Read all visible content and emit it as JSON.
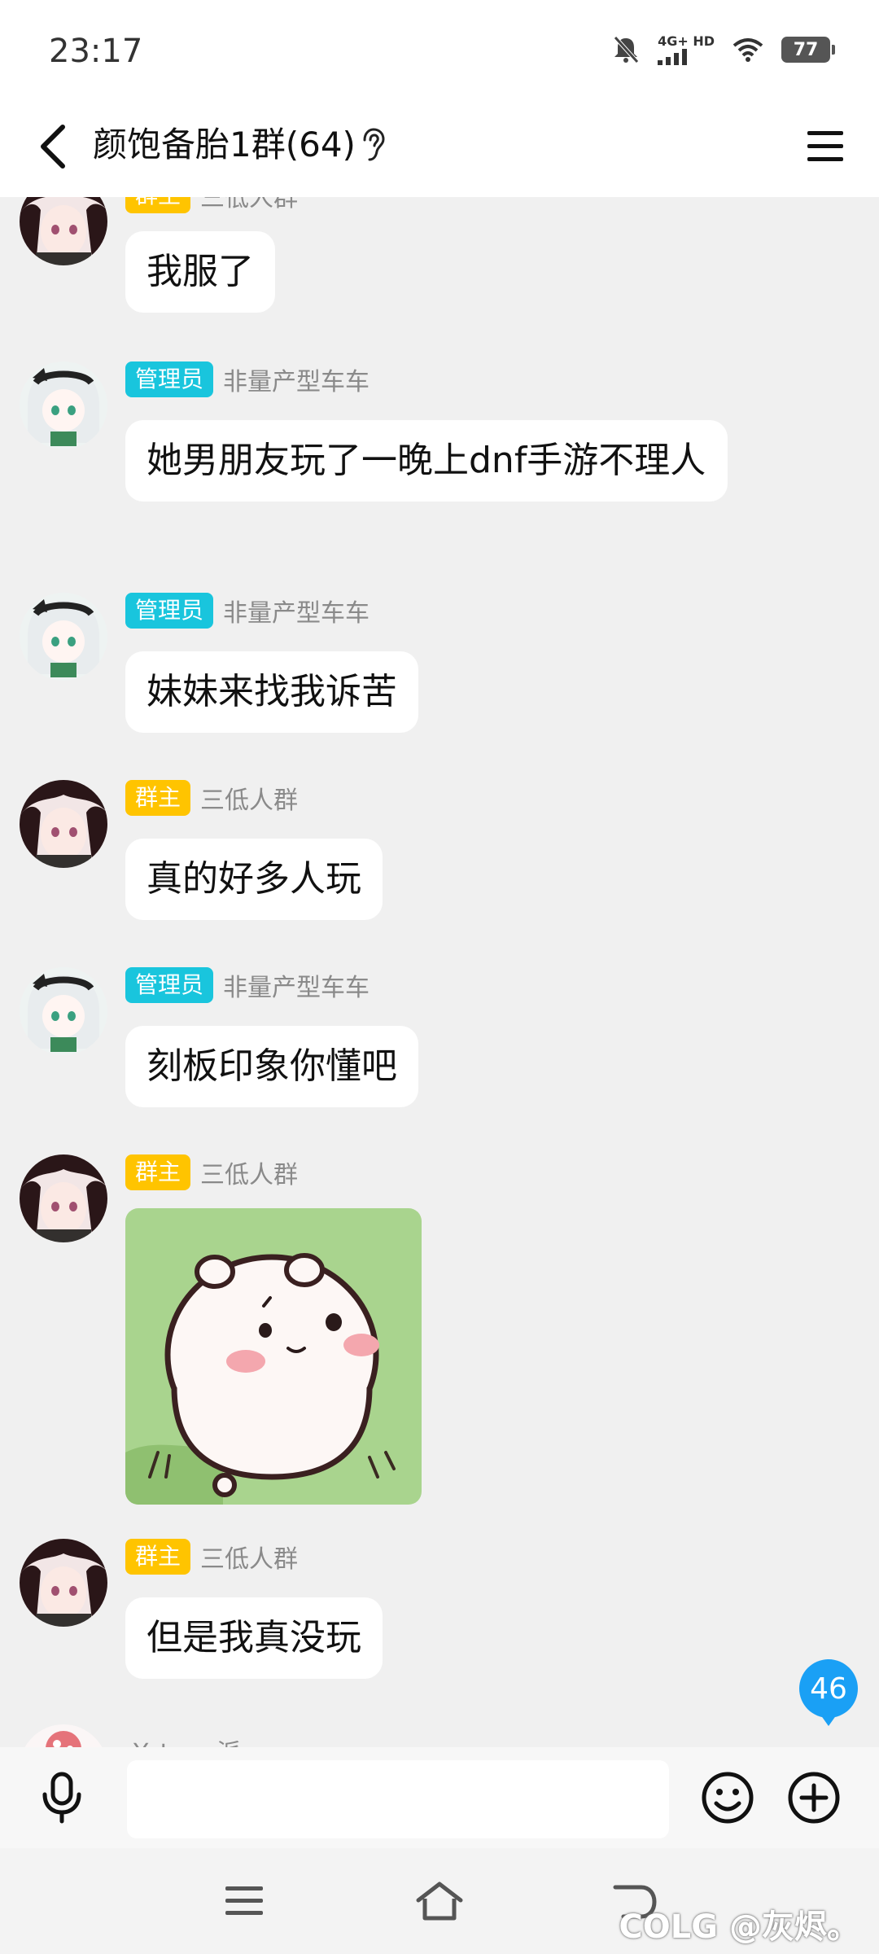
{
  "status_bar": {
    "time": "23:17",
    "network": "4G+ HD",
    "battery": "77"
  },
  "header": {
    "title": "颜饱备胎1群(64)"
  },
  "messages": [
    {
      "role": "群主",
      "sender": "三低人群",
      "text": "我服了"
    },
    {
      "role": "管理员",
      "sender": "非量产型车车",
      "text": "她男朋友玩了一晚上dnf手游不理人"
    },
    {
      "role": "管理员",
      "sender": "非量产型车车",
      "text": "妹妹来找我诉苦"
    },
    {
      "role": "群主",
      "sender": "三低人群",
      "text": "真的好多人玩"
    },
    {
      "role": "管理员",
      "sender": "非量产型车车",
      "text": "刻板印象你懂吧"
    },
    {
      "role": "群主",
      "sender": "三低人群",
      "sticker": "hamster-sticker"
    },
    {
      "role": "群主",
      "sender": "三低人群",
      "text": "但是我真没玩"
    },
    {
      "role": "",
      "sender": "Yatoro 派",
      "text": ""
    }
  ],
  "unread_count": "46",
  "input": {
    "value": "",
    "placeholder": ""
  },
  "watermark": "@灰烬。",
  "watermark_logo": "COLG",
  "colors": {
    "owner_badge": "#ffc400",
    "admin_badge": "#19c5dd",
    "unread_badge": "#1aa0f5",
    "background": "#f0f0f0"
  },
  "icons": [
    "back-icon",
    "ear-icon",
    "menu-icon",
    "microphone-icon",
    "emoji-icon",
    "plus-icon",
    "nav-menu-icon",
    "nav-home-icon",
    "nav-back-icon"
  ]
}
